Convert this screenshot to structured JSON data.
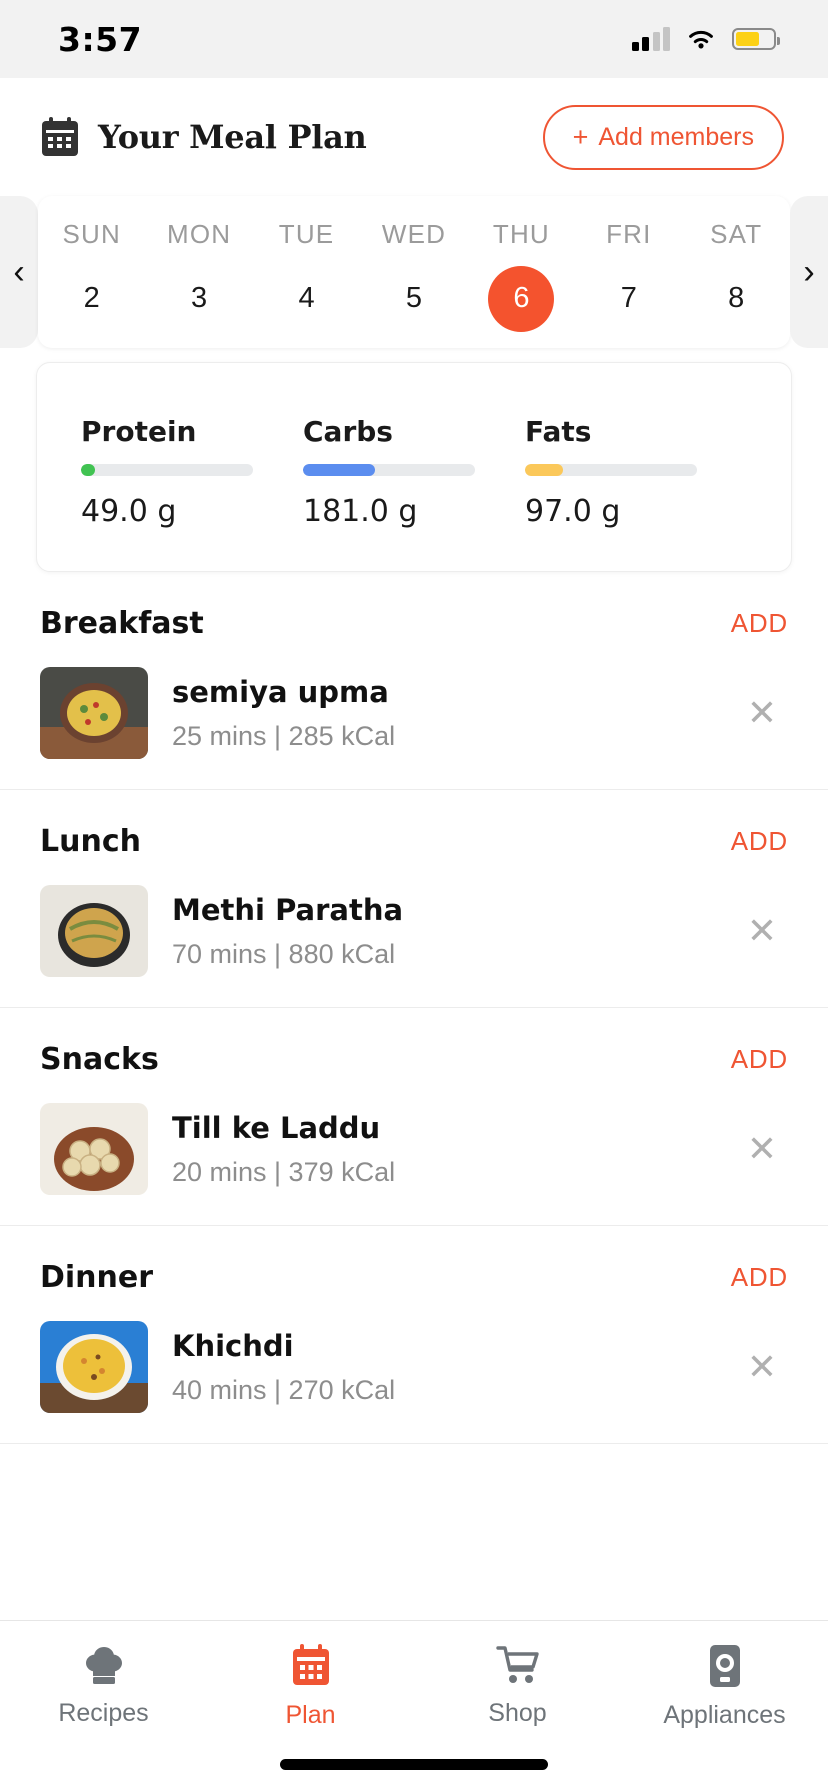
{
  "status_bar": {
    "time": "3:57",
    "signal_icon": "cellular-signal-icon",
    "wifi_icon": "wifi-icon",
    "battery_icon": "battery-icon",
    "battery_color": "#fcd116"
  },
  "header": {
    "calendar_icon": "calendar-icon",
    "title": "Your Meal Plan",
    "add_members_label": "Add members",
    "add_members_plus": "+",
    "accent_color": "#ef5533"
  },
  "week_strip": {
    "prev_arrow": "‹",
    "next_arrow": "›",
    "selected_index": 4,
    "selected_color": "#f4532e",
    "days": [
      {
        "dow": "SUN",
        "date": "2"
      },
      {
        "dow": "MON",
        "date": "3"
      },
      {
        "dow": "TUE",
        "date": "4"
      },
      {
        "dow": "WED",
        "date": "5"
      },
      {
        "dow": "THU",
        "date": "6"
      },
      {
        "dow": "FRI",
        "date": "7"
      },
      {
        "dow": "SAT",
        "date": "8"
      }
    ]
  },
  "macros": [
    {
      "label": "Protein",
      "value": "49.0 g",
      "fill_pct": 8,
      "color": "#41c352"
    },
    {
      "label": "Carbs",
      "value": "181.0 g",
      "fill_pct": 42,
      "color": "#5b8def"
    },
    {
      "label": "Fats",
      "value": "97.0 g",
      "fill_pct": 22,
      "color": "#fbc85a"
    }
  ],
  "meals": [
    {
      "name": "Breakfast",
      "add_label": "ADD",
      "item": {
        "title": "semiya upma",
        "meta": "25 mins | 285 kCal",
        "remove_icon": "close-icon",
        "thumb": {
          "bg": "#4a4b46",
          "bowl": "#6b4230",
          "food": "#e3c04a",
          "accent": "#5c8a3c"
        }
      }
    },
    {
      "name": "Lunch",
      "add_label": "ADD",
      "item": {
        "title": "Methi Paratha",
        "meta": "70 mins | 880 kCal",
        "remove_icon": "close-icon",
        "thumb": {
          "bg": "#e8e5de",
          "bowl": "#2b2b2b",
          "food": "#cfa44d",
          "accent": "#7a8c3f"
        }
      }
    },
    {
      "name": "Snacks",
      "add_label": "ADD",
      "item": {
        "title": "Till ke Laddu",
        "meta": "20 mins | 379 kCal",
        "remove_icon": "close-icon",
        "thumb": {
          "bg": "#f0ece4",
          "bowl": "#8a4a2a",
          "food": "#e8d9ae",
          "accent": "#c9b183"
        }
      }
    },
    {
      "name": "Dinner",
      "add_label": "ADD",
      "item": {
        "title": "Khichdi",
        "meta": "40 mins | 270 kCal",
        "remove_icon": "close-icon",
        "thumb": {
          "bg": "#2a7fd4",
          "bowl": "#f4f2ec",
          "food": "#edc03a",
          "accent": "#d4852f"
        }
      }
    }
  ],
  "tabbar": {
    "active_index": 1,
    "active_color": "#ef5533",
    "inactive_color": "#6e7479",
    "tabs": [
      {
        "label": "Recipes",
        "icon": "chef-hat-icon"
      },
      {
        "label": "Plan",
        "icon": "calendar-icon"
      },
      {
        "label": "Shop",
        "icon": "shopping-cart-icon"
      },
      {
        "label": "Appliances",
        "icon": "appliance-icon"
      }
    ]
  }
}
